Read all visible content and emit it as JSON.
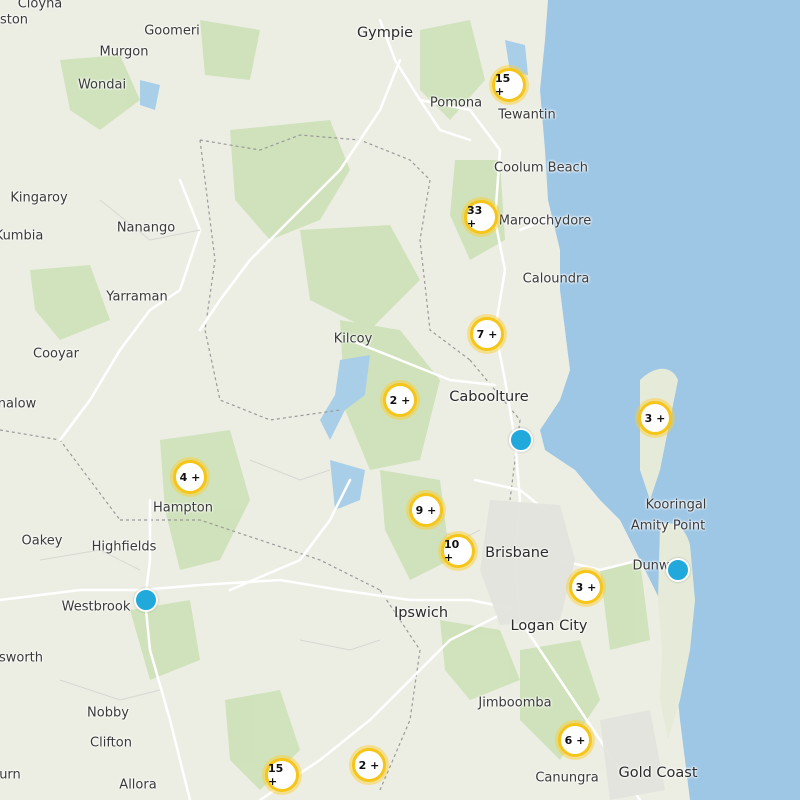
{
  "map": {
    "colors": {
      "land": "#eceee4",
      "sea": "#9ec7e6",
      "forest": "#cfe2b9",
      "road": "#ffffff",
      "boundary": "#9a9a9a",
      "water": "#a9cfe8",
      "cluster_ring": "#f6c51a",
      "marker": "#21a9dc"
    },
    "places": [
      {
        "name": "Cloyna",
        "type": "town"
      },
      {
        "name": "Gympie",
        "type": "city"
      },
      {
        "name": "Goomeri",
        "type": "town"
      },
      {
        "name": "Murgon",
        "type": "town"
      },
      {
        "name": "Wondai",
        "type": "town"
      },
      {
        "name": "Pomona",
        "type": "town"
      },
      {
        "name": "Tewantin",
        "type": "town"
      },
      {
        "name": "Coolum Beach",
        "type": "town"
      },
      {
        "name": "Kingaroy",
        "type": "town"
      },
      {
        "name": "Maroochydore",
        "type": "town"
      },
      {
        "name": "Nanango",
        "type": "town"
      },
      {
        "name": "Kumbia",
        "type": "town"
      },
      {
        "name": "Caloundra",
        "type": "town"
      },
      {
        "name": "Yarraman",
        "type": "town"
      },
      {
        "name": "Kilcoy",
        "type": "town"
      },
      {
        "name": "Cooyar",
        "type": "town"
      },
      {
        "name": "Caboolture",
        "type": "city"
      },
      {
        "name": "nalow",
        "type": "town"
      },
      {
        "name": "Hampton",
        "type": "town"
      },
      {
        "name": "Kooringal",
        "type": "town"
      },
      {
        "name": "Amity Point",
        "type": "town"
      },
      {
        "name": "Oakey",
        "type": "town"
      },
      {
        "name": "Highfields",
        "type": "town"
      },
      {
        "name": "Brisbane",
        "type": "city"
      },
      {
        "name": "Dunw",
        "type": "town"
      },
      {
        "name": "Westbrook",
        "type": "town"
      },
      {
        "name": "Ipswich",
        "type": "city"
      },
      {
        "name": "Logan City",
        "type": "city"
      },
      {
        "name": "sworth",
        "type": "town"
      },
      {
        "name": "Jimboomba",
        "type": "town"
      },
      {
        "name": "Nobby",
        "type": "town"
      },
      {
        "name": "Clifton",
        "type": "town"
      },
      {
        "name": "Canungra",
        "type": "town"
      },
      {
        "name": "Gold Coast",
        "type": "city"
      },
      {
        "name": "Allora",
        "type": "town"
      },
      {
        "name": "urn",
        "type": "town"
      },
      {
        "name": "ston",
        "type": "town"
      }
    ],
    "clusters": [
      {
        "label": "15 +",
        "icon": "cluster-icon"
      },
      {
        "label": "33 +",
        "icon": "cluster-icon"
      },
      {
        "label": "7 +",
        "icon": "cluster-icon"
      },
      {
        "label": "2 +",
        "icon": "cluster-icon"
      },
      {
        "label": "3 +",
        "icon": "cluster-icon"
      },
      {
        "label": "4 +",
        "icon": "cluster-icon"
      },
      {
        "label": "9 +",
        "icon": "cluster-icon"
      },
      {
        "label": "10 +",
        "icon": "cluster-icon"
      },
      {
        "label": "3 +",
        "icon": "cluster-icon"
      },
      {
        "label": "6 +",
        "icon": "cluster-icon"
      },
      {
        "label": "15 +",
        "icon": "cluster-icon"
      },
      {
        "label": "2 +",
        "icon": "cluster-icon"
      }
    ],
    "markers": [
      {
        "icon": "location-marker-icon"
      },
      {
        "icon": "location-marker-icon"
      },
      {
        "icon": "location-marker-icon"
      }
    ]
  }
}
